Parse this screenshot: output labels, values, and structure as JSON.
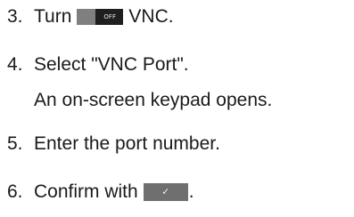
{
  "steps": [
    {
      "number": "3.",
      "before": "Turn",
      "toggle_label": "OFF",
      "after": "VNC."
    },
    {
      "number": "4.",
      "text": "Select \"VNC Port\"."
    },
    {
      "result": "An on-screen keypad opens."
    },
    {
      "number": "5.",
      "text": "Enter the port number."
    },
    {
      "number": "6.",
      "before": "Confirm with",
      "after": "."
    }
  ],
  "icons": {
    "toggle": "off-toggle-icon",
    "confirm": "checkmark-button-icon"
  },
  "colors": {
    "text": "#1a1a1a",
    "toggle_bg": "#1f1f1f",
    "toggle_knob": "#7f7f7f",
    "confirm_bg": "#6f6f6f"
  }
}
